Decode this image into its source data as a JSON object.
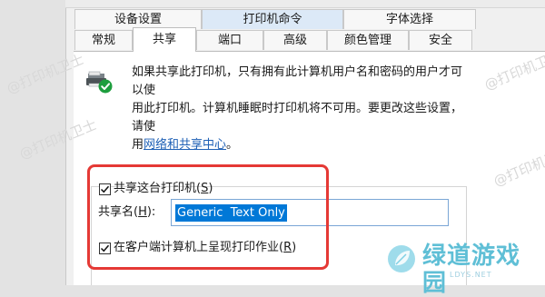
{
  "tabs": {
    "row1": [
      {
        "id": "device-settings",
        "label": "设备设置"
      },
      {
        "id": "printer-commands",
        "label": "打印机命令"
      },
      {
        "id": "font-selection",
        "label": "字体选择"
      }
    ],
    "row2": [
      {
        "id": "general",
        "label": "常规"
      },
      {
        "id": "sharing",
        "label": "共享"
      },
      {
        "id": "ports",
        "label": "端口"
      },
      {
        "id": "advanced",
        "label": "高级"
      },
      {
        "id": "color-management",
        "label": "颜色管理"
      },
      {
        "id": "security",
        "label": "安全"
      }
    ],
    "active": "共享"
  },
  "description": {
    "line1": "如果共享此打印机，只有拥有此计算机用户名和密码的用户才可以使",
    "line2": "用此打印机。计算机睡眠时打印机将不可用。要更改这些设置，请使",
    "line3_prefix": "用",
    "link": "网络和共享中心",
    "line3_suffix": "。"
  },
  "share_printer": {
    "checked": true,
    "label": "共享这台打印机(",
    "accel": "S",
    "label_end": ")"
  },
  "share_name": {
    "label": "共享名(",
    "accel": "H",
    "label_end": "):",
    "value": "Generic  Text Only"
  },
  "render_jobs": {
    "checked": true,
    "label": "在客户端计算机上呈现打印作业(",
    "accel": "R",
    "label_end": ")"
  },
  "watermark": "@打印机卫士",
  "brand": {
    "name": "绿道游戏园",
    "url": "LDYS.NET"
  },
  "colors": {
    "accent_blue": "#0078d7",
    "link_blue": "#1d5fb5",
    "highlight_red": "#e53935",
    "brand_teal": "#5fbfd6"
  },
  "icons": {
    "printer": "printer-shared-icon",
    "check": "checkmark-icon"
  }
}
